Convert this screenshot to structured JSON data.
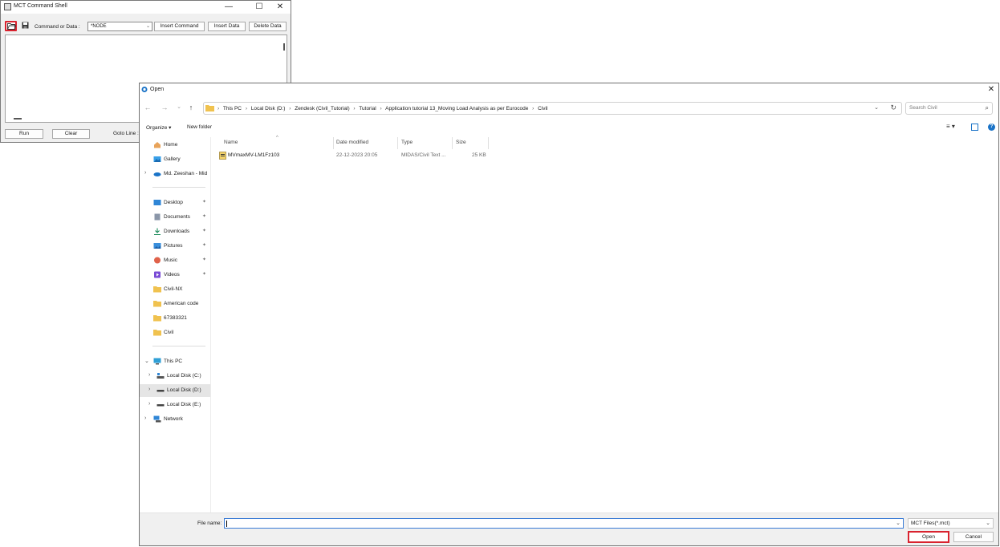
{
  "mct": {
    "title": "MCT Command Shell",
    "controls": {
      "minimize": "—",
      "maximize": "☐",
      "close": "✕"
    },
    "toolbar": {
      "label": "Command or Data :",
      "select_value": "*NODE",
      "insert_command": "Insert Command",
      "insert_data": "Insert Data",
      "delete_data": "Delete Data"
    },
    "bottom": {
      "run": "Run",
      "clear": "Clear",
      "goto_line": "Goto Line :"
    }
  },
  "dialog": {
    "title": "Open",
    "close": "✕",
    "nav": {
      "back": "←",
      "forward": "→",
      "down": "⌄",
      "up": "↑"
    },
    "breadcrumbs": [
      "This PC",
      "Local Disk (D:)",
      "Zendesk (Civil_Tutorial)",
      "Tutorial",
      "Application tutorial 13_Moving Load Analysis as per Eurocode",
      "Civil"
    ],
    "search_placeholder": "Search Civil",
    "commands": {
      "organize": "Organize ▾",
      "new_folder": "New folder"
    },
    "nav_pane": {
      "quick": [
        {
          "label": "Home",
          "icon": "home-icon"
        },
        {
          "label": "Gallery",
          "icon": "gallery-icon"
        },
        {
          "label": "Md. Zeeshan - Mid",
          "icon": "onedrive-icon"
        }
      ],
      "pinned": [
        {
          "label": "Desktop",
          "icon": "desktop-icon"
        },
        {
          "label": "Documents",
          "icon": "documents-icon"
        },
        {
          "label": "Downloads",
          "icon": "downloads-icon"
        },
        {
          "label": "Pictures",
          "icon": "pictures-icon"
        },
        {
          "label": "Music",
          "icon": "music-icon"
        },
        {
          "label": "Videos",
          "icon": "videos-icon"
        }
      ],
      "folders": [
        "Civil-NX",
        "American code",
        "67383321",
        "Civil"
      ],
      "this_pc": "This PC",
      "drives": [
        "Local Disk (C:)",
        "Local Disk (D:)",
        "Local Disk (E:)"
      ],
      "network": "Network"
    },
    "columns": {
      "name": "Name",
      "date": "Date modified",
      "type": "Type",
      "size": "Size"
    },
    "files": [
      {
        "name": "MVmaxMV-LM1Fz103",
        "date": "22-12-2023 20:05",
        "type": "MIDAS/Civil Text ...",
        "size": "25 KB"
      }
    ],
    "bottom": {
      "file_name_label": "File name:",
      "file_name_value": "",
      "filter": "MCT Files(*.mct)",
      "open": "Open",
      "cancel": "Cancel"
    },
    "colors": {
      "highlight": "#d9232f",
      "folder": "#f0c24f",
      "accent": "#1a73c7"
    }
  }
}
